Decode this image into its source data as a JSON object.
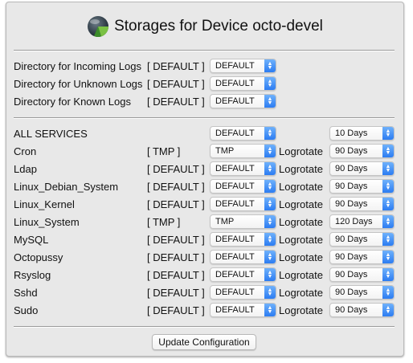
{
  "title": "Storages for Device octo-devel",
  "dirs": [
    {
      "label": "Directory for Incoming Logs",
      "bracket": "[ DEFAULT ]",
      "value": "DEFAULT"
    },
    {
      "label": "Directory for Unknown Logs",
      "bracket": "[ DEFAULT ]",
      "value": "DEFAULT"
    },
    {
      "label": "Directory for Known Logs",
      "bracket": "[ DEFAULT ]",
      "value": "DEFAULT"
    }
  ],
  "all_services": {
    "label": "ALL SERVICES",
    "value": "DEFAULT",
    "rotate": "10 Days"
  },
  "logrotate_label": "Logrotate",
  "services": [
    {
      "name": "Cron",
      "bracket": "[ TMP ]",
      "value": "TMP",
      "rotate": "90 Days"
    },
    {
      "name": "Ldap",
      "bracket": "[ DEFAULT ]",
      "value": "DEFAULT",
      "rotate": "90 Days"
    },
    {
      "name": "Linux_Debian_System",
      "bracket": "[ DEFAULT ]",
      "value": "DEFAULT",
      "rotate": "90 Days"
    },
    {
      "name": "Linux_Kernel",
      "bracket": "[ DEFAULT ]",
      "value": "DEFAULT",
      "rotate": "90 Days"
    },
    {
      "name": "Linux_System",
      "bracket": "[ TMP ]",
      "value": "TMP",
      "rotate": "120 Days"
    },
    {
      "name": "MySQL",
      "bracket": "[ DEFAULT ]",
      "value": "DEFAULT",
      "rotate": "90 Days"
    },
    {
      "name": "Octopussy",
      "bracket": "[ DEFAULT ]",
      "value": "DEFAULT",
      "rotate": "90 Days"
    },
    {
      "name": "Rsyslog",
      "bracket": "[ DEFAULT ]",
      "value": "DEFAULT",
      "rotate": "90 Days"
    },
    {
      "name": "Sshd",
      "bracket": "[ DEFAULT ]",
      "value": "DEFAULT",
      "rotate": "90 Days"
    },
    {
      "name": "Sudo",
      "bracket": "[ DEFAULT ]",
      "value": "DEFAULT",
      "rotate": "90 Days"
    }
  ],
  "update_button": "Update Configuration",
  "colors": {
    "accent": "#2c7cf2",
    "panel": "#e8e8e8"
  }
}
